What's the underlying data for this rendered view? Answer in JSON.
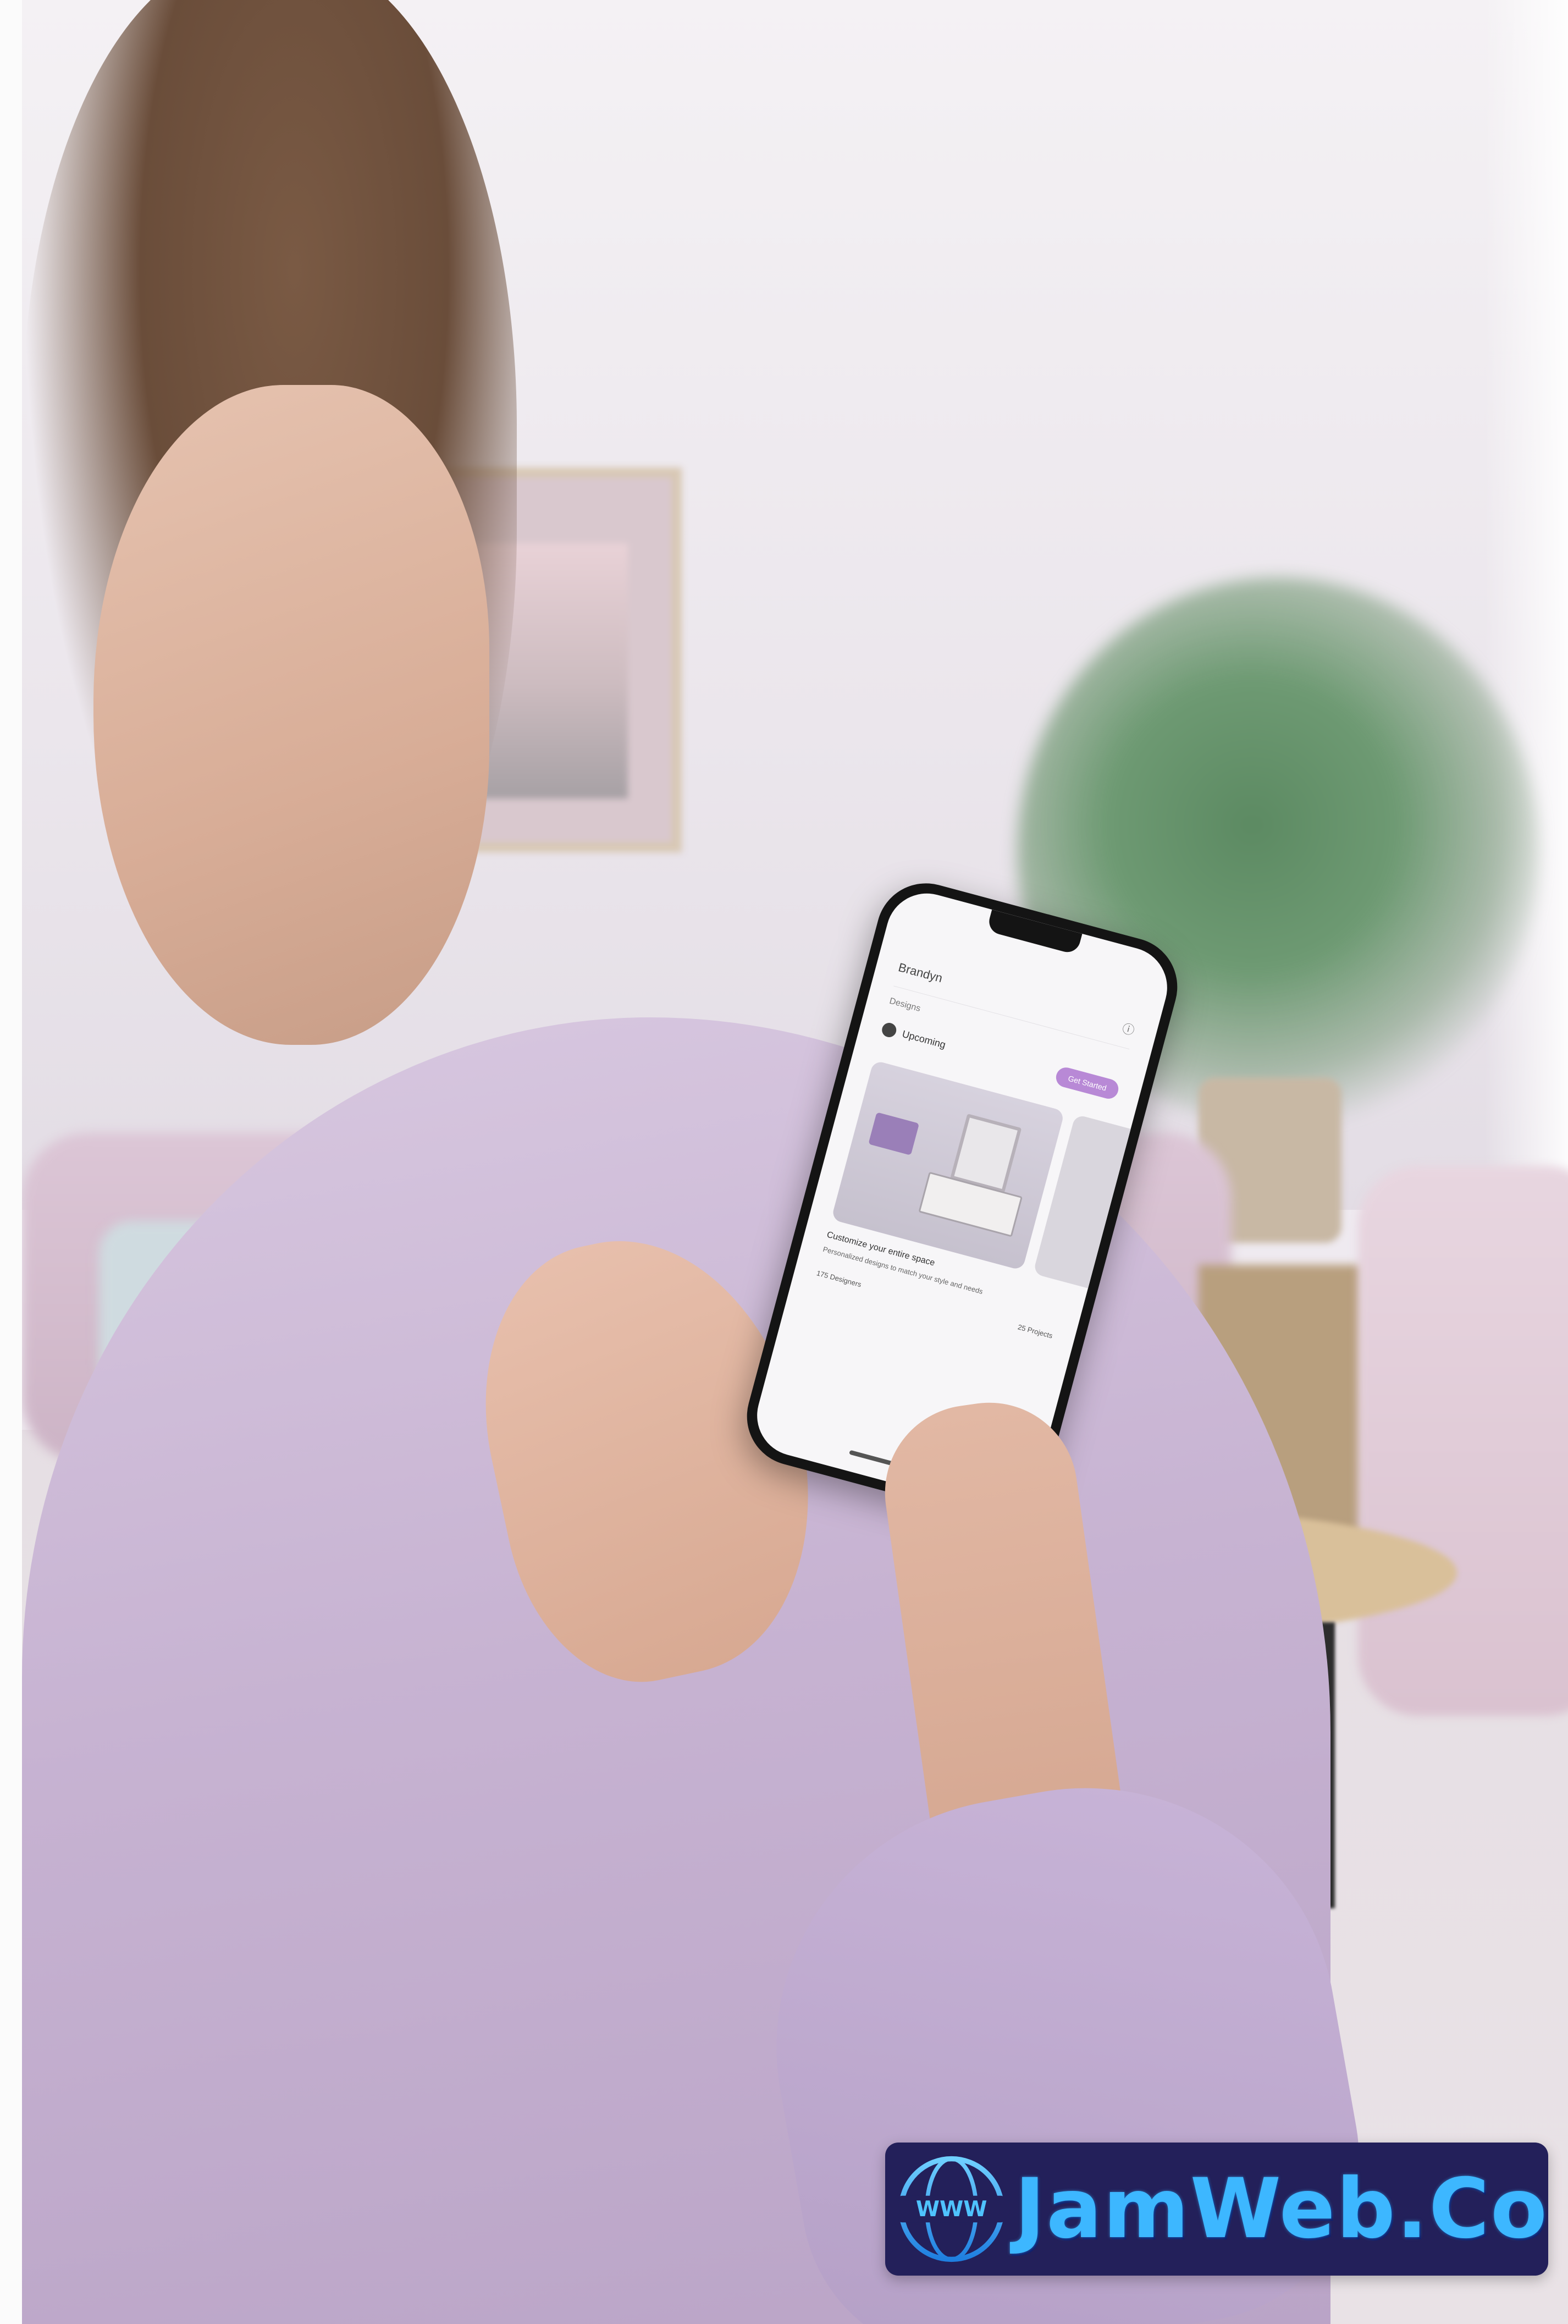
{
  "phone_app": {
    "header_title": "Brandyn",
    "section_label": "Designs",
    "user_name": "Upcoming",
    "cta_label": "Get Started",
    "card_title": "Customize your entire space",
    "card_description": "Personalized designs to match your style and needs",
    "meta_left": "175 Designers",
    "meta_right": "25 Projects"
  },
  "logo": {
    "text": "JamWeb.Co",
    "globe_text": "WWW",
    "colors": {
      "badge": "#23205a",
      "text": "#3db7ff"
    }
  },
  "colors": {
    "accent": "#b889d6",
    "sweater": "#c7b3d2",
    "wall": "#efeaf0"
  }
}
